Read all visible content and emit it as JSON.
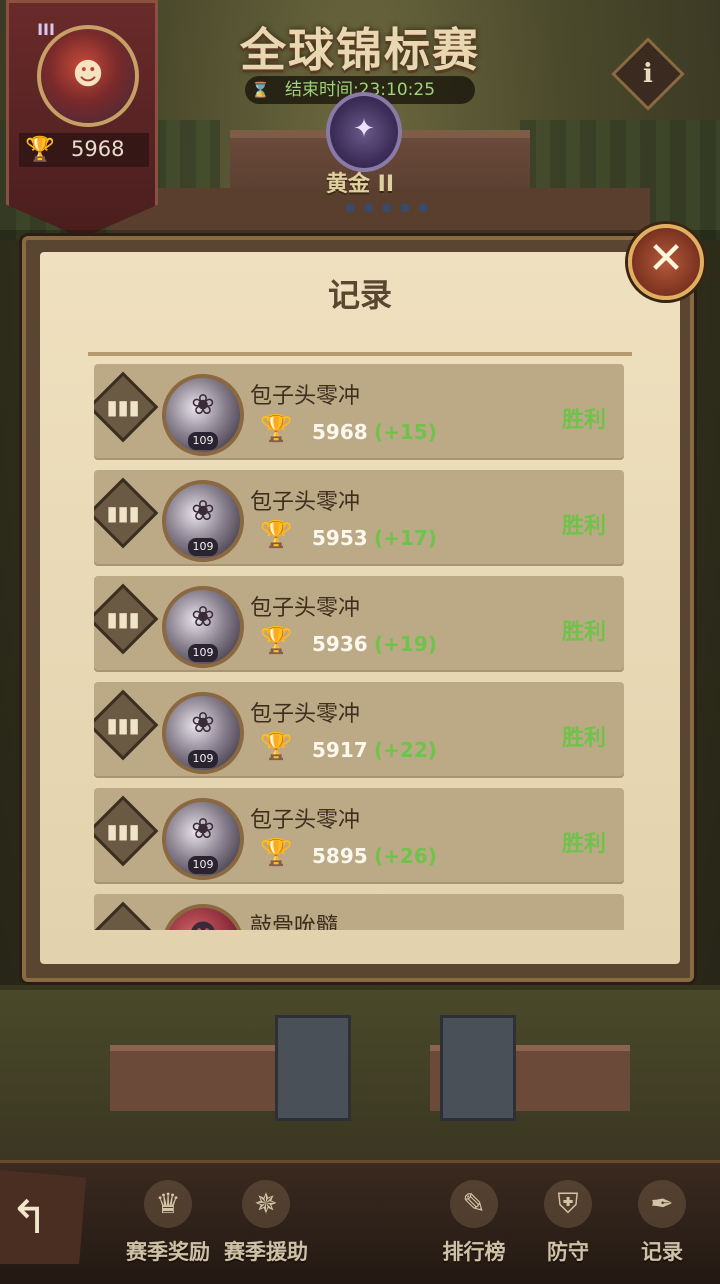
{
  "header": {
    "title": "全球锦标赛",
    "timer": "结束时间:23:10:25",
    "rank_name": "黄金 II",
    "info_icon": "i"
  },
  "player": {
    "tier_badge": "III",
    "score": "5968"
  },
  "dialog": {
    "title": "记录",
    "close_icon": "✕"
  },
  "records": [
    {
      "name": "包子头零冲",
      "level": "109",
      "score": "5968",
      "delta": "(+15)",
      "result": "胜利"
    },
    {
      "name": "包子头零冲",
      "level": "109",
      "score": "5953",
      "delta": "(+17)",
      "result": "胜利"
    },
    {
      "name": "包子头零冲",
      "level": "109",
      "score": "5936",
      "delta": "(+19)",
      "result": "胜利"
    },
    {
      "name": "包子头零冲",
      "level": "109",
      "score": "5917",
      "delta": "(+22)",
      "result": "胜利"
    },
    {
      "name": "包子头零冲",
      "level": "109",
      "score": "5895",
      "delta": "(+26)",
      "result": "胜利"
    },
    {
      "name": "敲骨吮髓"
    }
  ],
  "bottom_nav": [
    {
      "label": "赛季奖励",
      "icon": "crest-icon"
    },
    {
      "label": "赛季援助",
      "icon": "compass-badge-icon"
    },
    {
      "label": "排行榜",
      "icon": "scroll-icon"
    },
    {
      "label": "防守",
      "icon": "shield-icon"
    },
    {
      "label": "记录",
      "icon": "quill-icon"
    }
  ],
  "colors": {
    "win": "#6fc34a",
    "trophy": "#e0a828",
    "panel": "#efe0bf"
  }
}
